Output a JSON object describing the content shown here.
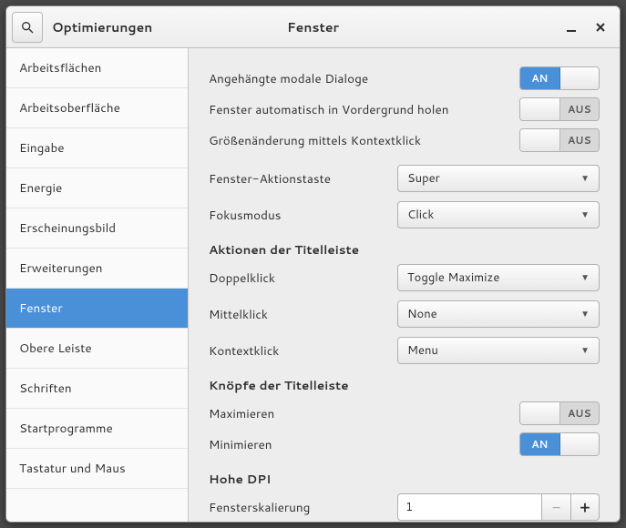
{
  "titlebar": {
    "app_title": "Optimierungen",
    "page_title": "Fenster"
  },
  "sidebar": {
    "items": [
      {
        "label": "Arbeitsflächen"
      },
      {
        "label": "Arbeitsoberfläche"
      },
      {
        "label": "Eingabe"
      },
      {
        "label": "Energie"
      },
      {
        "label": "Erscheinungsbild"
      },
      {
        "label": "Erweiterungen"
      },
      {
        "label": "Fenster",
        "selected": true
      },
      {
        "label": "Obere Leiste"
      },
      {
        "label": "Schriften"
      },
      {
        "label": "Startprogramme"
      },
      {
        "label": "Tastatur und Maus"
      }
    ]
  },
  "content": {
    "attached_dialogs": {
      "label": "Angehängte modale Dialoge",
      "state": "on",
      "on": "AN",
      "off": "AUS"
    },
    "raise_auto": {
      "label": "Fenster automatisch in Vordergrund holen",
      "state": "off",
      "on": "AN",
      "off": "AUS"
    },
    "resize_context": {
      "label": "Größenänderung mittels Kontextklick",
      "state": "off",
      "on": "AN",
      "off": "AUS"
    },
    "action_key": {
      "label": "Fenster-Aktionstaste",
      "value": "Super"
    },
    "focus_mode": {
      "label": "Fokusmodus",
      "value": "Click"
    },
    "section_titlebar_actions": "Aktionen der Titelleiste",
    "double_click": {
      "label": "Doppelklick",
      "value": "Toggle Maximize"
    },
    "middle_click": {
      "label": "Mittelklick",
      "value": "None"
    },
    "context_click": {
      "label": "Kontextklick",
      "value": "Menu"
    },
    "section_titlebar_buttons": "Knöpfe der Titelleiste",
    "maximize": {
      "label": "Maximieren",
      "state": "off",
      "on": "AN",
      "off": "AUS"
    },
    "minimize": {
      "label": "Minimieren",
      "state": "on",
      "on": "AN",
      "off": "AUS"
    },
    "section_dpi": "Hohe DPI",
    "scaling": {
      "label": "Fensterskalierung",
      "value": "1"
    }
  }
}
